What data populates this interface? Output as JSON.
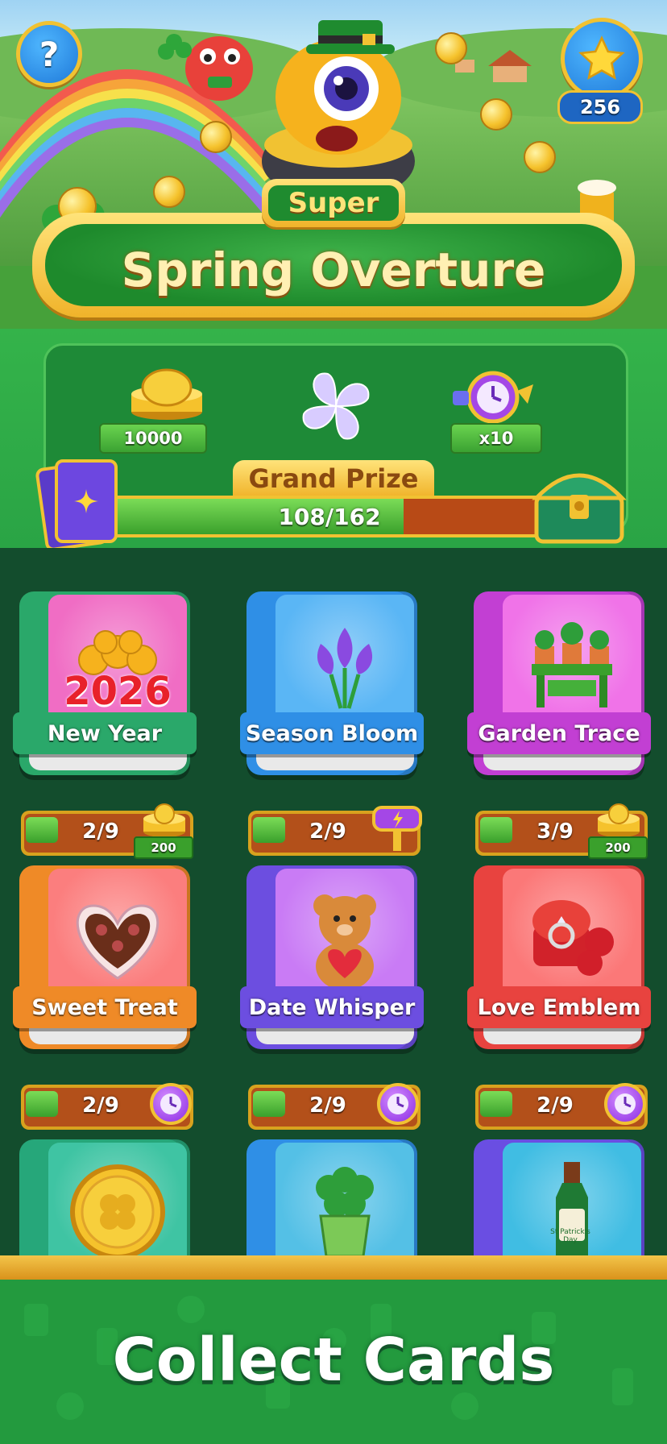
{
  "header": {
    "star_count": "256",
    "subtitle": "Super",
    "title": "Spring Overture"
  },
  "prize_panel": {
    "rewards": [
      {
        "icon": "coin-stack-icon",
        "label": "10000"
      },
      {
        "icon": "crystal-clover-icon",
        "label": ""
      },
      {
        "icon": "alarm-clock-icon",
        "label": "x10"
      }
    ],
    "grand_prize_label": "Grand Prize",
    "progress_text": "108/162",
    "progress_fraction": 0.667
  },
  "albums": [
    {
      "name": "New Year",
      "progress": "2/9",
      "reward": "200",
      "reward_icon": "coin-stack-icon",
      "color": "#2aa86a",
      "cover": "#f06dc4",
      "art_text": "2026"
    },
    {
      "name": "Season Bloom",
      "progress": "2/9",
      "reward": "",
      "reward_icon": "hammer-icon",
      "color": "#2f8fe6",
      "cover": "#5ab6f5",
      "art_text": ""
    },
    {
      "name": "Garden Trace",
      "progress": "3/9",
      "reward": "200",
      "reward_icon": "coin-stack-icon",
      "color": "#c23fd3",
      "cover": "#f073e8",
      "art_text": ""
    },
    {
      "name": "Sweet Treat",
      "progress": "2/9",
      "reward": "",
      "reward_icon": "alarm-clock-icon",
      "color": "#ef8a27",
      "cover": "#fb7e7e",
      "art_text": ""
    },
    {
      "name": "Date Whisper",
      "progress": "2/9",
      "reward": "",
      "reward_icon": "alarm-clock-icon",
      "color": "#6c4ee0",
      "cover": "#c97bf5",
      "art_text": ""
    },
    {
      "name": "Love Emblem",
      "progress": "2/9",
      "reward": "",
      "reward_icon": "alarm-clock-icon",
      "color": "#e8433f",
      "cover": "#fb7878",
      "art_text": ""
    },
    {
      "name": "",
      "progress": "",
      "reward": "",
      "reward_icon": "",
      "color": "#26a77a",
      "cover": "#3fc4a3",
      "art_text": ""
    },
    {
      "name": "",
      "progress": "",
      "reward": "",
      "reward_icon": "",
      "color": "#2f8fe6",
      "cover": "#54c0e6",
      "art_text": ""
    },
    {
      "name": "",
      "progress": "",
      "reward": "",
      "reward_icon": "",
      "color": "#6a4ee2",
      "cover": "#40bde3",
      "art_text": "St Patrick's Day"
    }
  ],
  "footer": {
    "caption": "Collect Cards"
  }
}
